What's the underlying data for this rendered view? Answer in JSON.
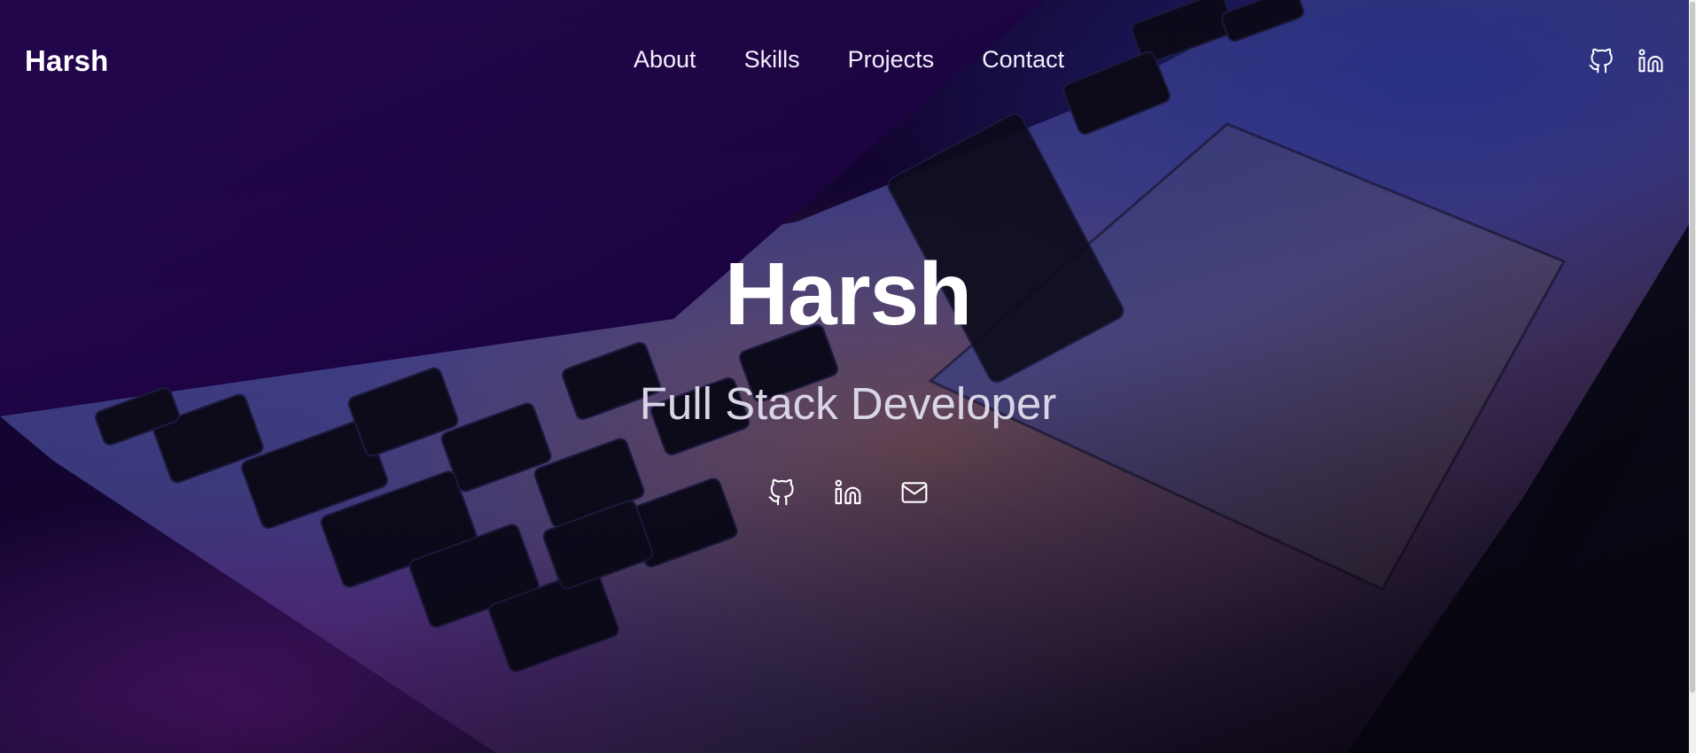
{
  "brand": "Harsh",
  "nav": {
    "links": [
      "About",
      "Skills",
      "Projects",
      "Contact"
    ],
    "social_icons": [
      "github-icon",
      "linkedin-icon"
    ]
  },
  "hero": {
    "title": "Harsh",
    "subtitle": "Full Stack Developer",
    "social_icons": [
      "github-icon",
      "linkedin-icon",
      "mail-icon"
    ]
  },
  "colors": {
    "text_primary": "#ffffff",
    "text_subtitle": "#d9d4e6",
    "accent_purple": "#3a0a6b"
  }
}
